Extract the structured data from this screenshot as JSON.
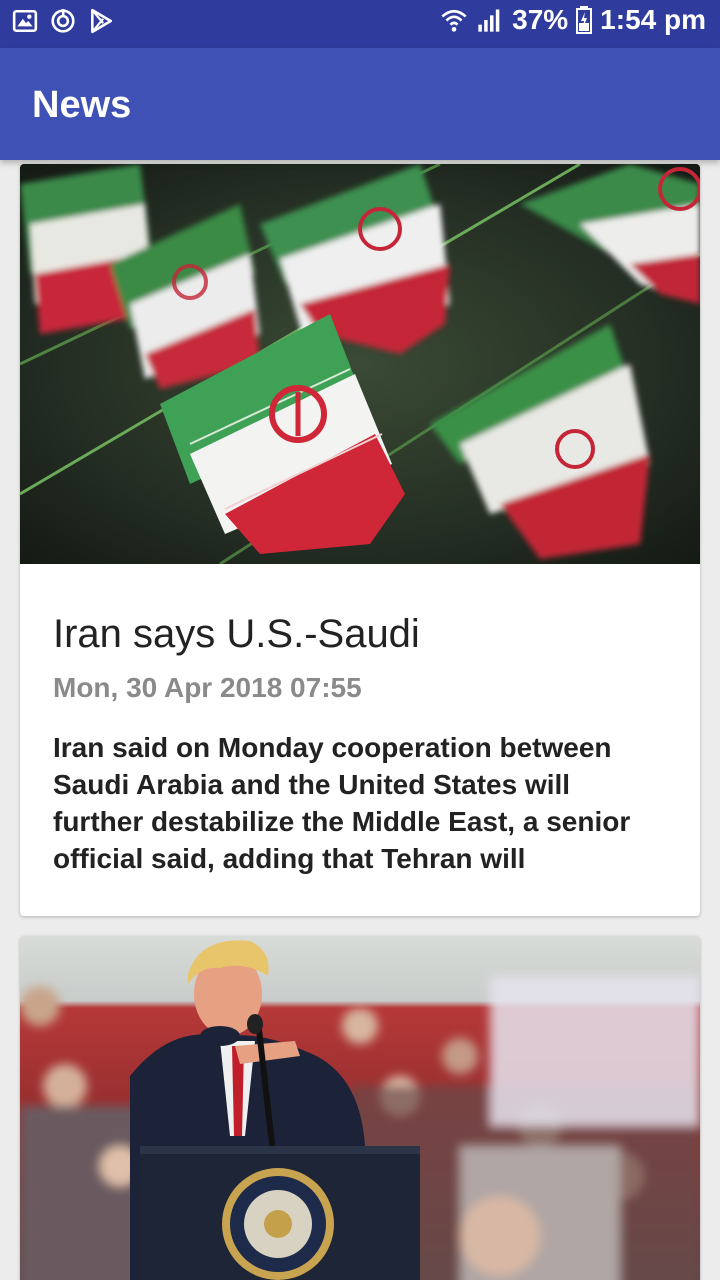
{
  "status_bar": {
    "battery": "37%",
    "time": "1:54 pm",
    "left_icons": [
      "gallery-icon",
      "sync-icon",
      "play-store-icon"
    ],
    "right_icons": [
      "wifi-icon",
      "signal-icon",
      "battery-icon"
    ]
  },
  "app_bar": {
    "title": "News",
    "background": "#3f51b5",
    "status_background": "#2f3c9e"
  },
  "articles": [
    {
      "image": "iran-flags-photo",
      "title": "Iran says U.S.-Saudi",
      "date": "Mon, 30 Apr 2018 07:55",
      "description": "Iran said on Monday cooperation between Saudi Arabia and the United States will further destabilize the Middle East, a senior official said, adding that Tehran will"
    },
    {
      "image": "rally-speaker-photo"
    }
  ]
}
